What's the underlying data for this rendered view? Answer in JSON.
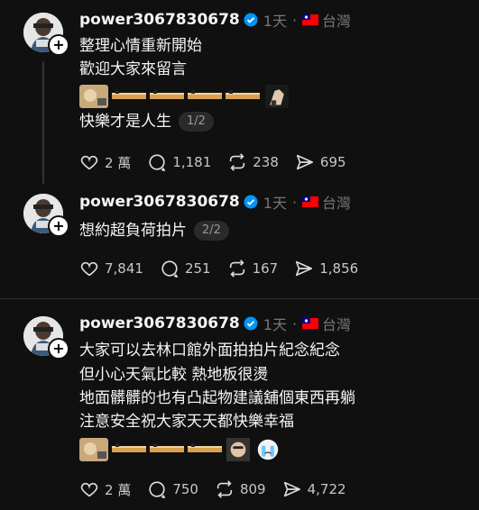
{
  "posts": [
    {
      "username": "power3067830678",
      "time": "1天",
      "location": "台灣",
      "lines": [
        "整理心情重新開始",
        "歡迎大家來留言"
      ],
      "last_line": "快樂才是人生",
      "pager": "1/2",
      "likes": "2 萬",
      "replies": "1,181",
      "reposts": "238",
      "shares": "695"
    },
    {
      "username": "power3067830678",
      "time": "1天",
      "location": "台灣",
      "last_line": "想約超負荷拍片",
      "pager": "2/2",
      "likes": "7,841",
      "replies": "251",
      "reposts": "167",
      "shares": "1,856"
    },
    {
      "username": "power3067830678",
      "time": "1天",
      "location": "台灣",
      "lines": [
        "大家可以去林口館外面拍拍片紀念紀念",
        "但小心天氣比較 熱地板很燙",
        "地面髒髒的也有凸起物建議舖個東西再躺",
        "注意安全祝大家天天都快樂幸福"
      ],
      "likes": "2 萬",
      "replies": "750",
      "reposts": "809",
      "shares": "4,722"
    }
  ],
  "separator_middle": "·",
  "icons": {
    "verified": "verified-badge-icon",
    "flag": "taiwan-flag-icon",
    "like": "heart-icon",
    "reply": "comment-icon",
    "repost": "repost-icon",
    "share": "send-icon",
    "follow": "plus-icon"
  },
  "colors": {
    "background": "#101010",
    "text": "#f3f5f7",
    "muted": "#777777",
    "verified": "#0095f6"
  }
}
